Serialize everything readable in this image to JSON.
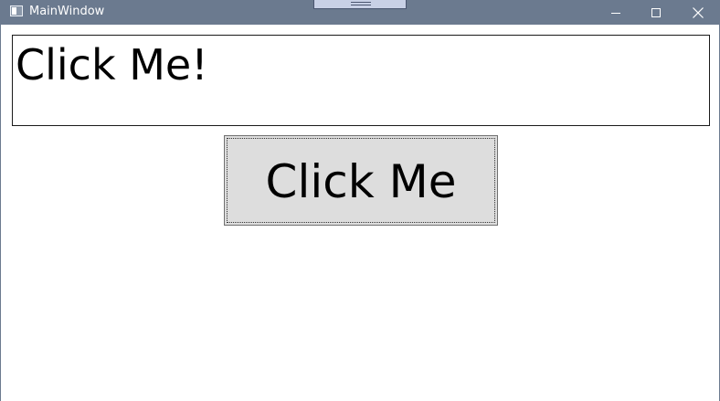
{
  "window": {
    "title": "MainWindow",
    "titlebar_color": "#6b7a8f",
    "buttons": {
      "minimize": "minimize-icon",
      "maximize": "maximize-icon",
      "close": "close-icon"
    }
  },
  "textbox": {
    "value": "Click Me!"
  },
  "main_button": {
    "label": "Click Me",
    "background": "#dddddd"
  }
}
